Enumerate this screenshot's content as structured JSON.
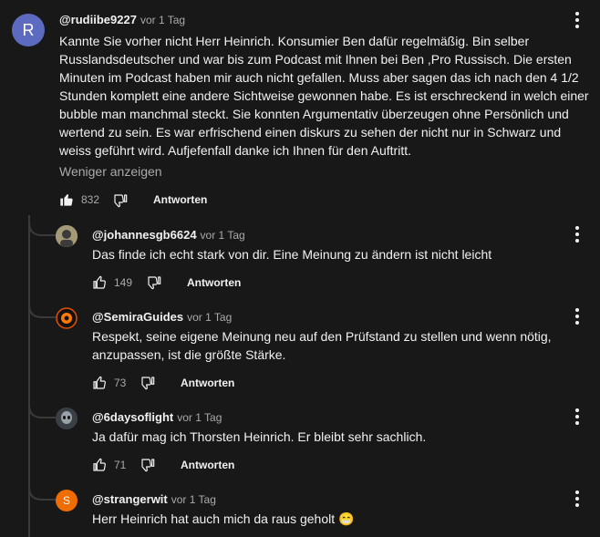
{
  "colors": {
    "background": "#181818",
    "text": "#f1f1f1",
    "muted": "#aaaaaa",
    "thread_line": "#3a3a3a"
  },
  "main_comment": {
    "avatar_letter": "R",
    "avatar_color": "#5c6bc0",
    "author": "@rudiibe9227",
    "time": "vor 1 Tag",
    "text_lines": [
      "Kannte Sie vorher nicht Herr Heinrich. Konsumier Ben dafür regelmäßig. Bin selber",
      "Russlandsdeutscher und war bis zum Podcast mit Ihnen bei Ben ,Pro Russisch. Die ersten",
      "Minuten im Podcast haben mir auch nicht gefallen. Muss aber sagen das ich nach den 4 1/2",
      "Stunden komplett eine andere Sichtweise gewonnen habe. Es ist erschreckend in welch einer",
      "bubble man manchmal steckt. Sie konnten Argumentativ überzeugen ohne Persönlich und",
      "wertend zu sein. Es war erfrischend  einen diskurs zu sehen der nicht nur in Schwarz und",
      "weiss geführt wird. Aufjefenfall danke ich Ihnen für den Auftritt."
    ],
    "show_less": "Weniger anzeigen",
    "likes": "832",
    "reply_label": "Antworten",
    "liked": true
  },
  "replies": [
    {
      "author": "@johannesgb6624",
      "time": "vor 1 Tag",
      "avatar_type": "photo",
      "text_lines": [
        "Das finde ich echt stark von dir. Eine Meinung zu ändern ist nicht leicht"
      ],
      "likes": "149",
      "reply_label": "Antworten"
    },
    {
      "author": "@SemiraGuides",
      "time": "vor 1 Tag",
      "avatar_type": "logo",
      "text_lines": [
        "Respekt, seine eigene Meinung neu auf den Prüfstand zu stellen und wenn nötig,",
        "anzupassen, ist die größte Stärke."
      ],
      "likes": "73",
      "reply_label": "Antworten"
    },
    {
      "author": "@6daysoflight",
      "time": "vor 1 Tag",
      "avatar_type": "photo-dark",
      "text_lines": [
        "Ja dafür mag ich Thorsten Heinrich. Er bleibt sehr sachlich."
      ],
      "likes": "71",
      "reply_label": "Antworten"
    },
    {
      "author": "@strangerwit",
      "time": "vor 1 Tag",
      "avatar_type": "letter",
      "avatar_letter": "S",
      "avatar_color": "#ef6c00",
      "text_lines": [
        "Herr Heinrich hat auch mich da raus geholt 😁"
      ]
    }
  ],
  "icons": {
    "like": "thumbs-up-icon",
    "dislike": "thumbs-down-icon",
    "menu": "more-vert-icon",
    "connector": "thread-connector"
  }
}
